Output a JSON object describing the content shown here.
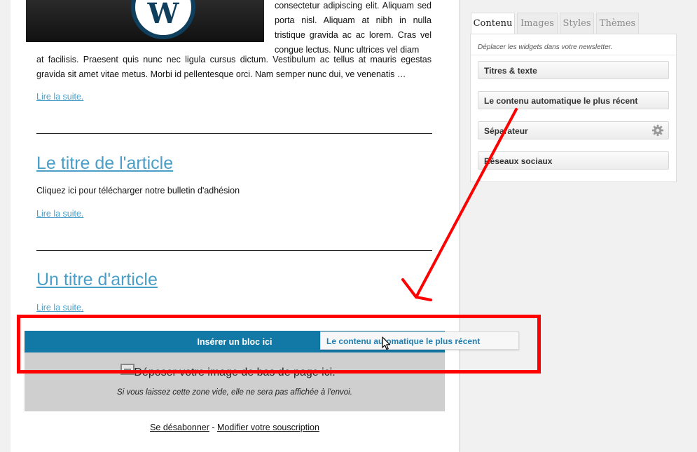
{
  "newsletter": {
    "side_text": "consectetur adipiscing elit. Aliquam sed porta nisl. Aliquam at nibh in nulla tristique gravida ac ac lorem. Cras vel congue lectus. Nunc ultrices vel diam",
    "full_text": "at facilisis. Praesent quis nunc nec ligula cursus dictum. Vestibulum ac tellus at mauris egestas gravida sit amet vitae metus. Morbi id pellentesque orci. Nam semper nunc dui, ve venenatis …",
    "articles": [
      {
        "read_more": "Lire la suite."
      },
      {
        "title": "Le titre de l'article",
        "body": "Cliquez ici pour télécharger notre bulletin d'adhésion",
        "read_more": "Lire la suite."
      },
      {
        "title": "Un titre d'article",
        "read_more": "Lire la suite."
      }
    ],
    "insert_block": "Insérer un bloc ici",
    "footer_image_title": "Déposer votre image de bas de page ici.",
    "footer_image_note": "Si vous laissez cette zone vide, elle ne sera pas affichée à l'envoi.",
    "unsubscribe": "Se désabonner",
    "separator": " - ",
    "modify_subscription": "Modifier votre souscription"
  },
  "drag": {
    "label": "Le contenu automatique le plus récent"
  },
  "panel": {
    "tabs": [
      "Contenu",
      "Images",
      "Styles",
      "Thèmes"
    ],
    "active_tab": "Contenu",
    "hint": "Déplacer les widgets dans votre newsletter.",
    "widgets": [
      "Titres & texte",
      "Le contenu automatique le plus récent",
      "Séparateur",
      "Réseaux sociaux"
    ]
  },
  "colors": {
    "link": "#4a9ec7",
    "insert_bar": "#1279a6",
    "annotation": "#ff0000"
  }
}
